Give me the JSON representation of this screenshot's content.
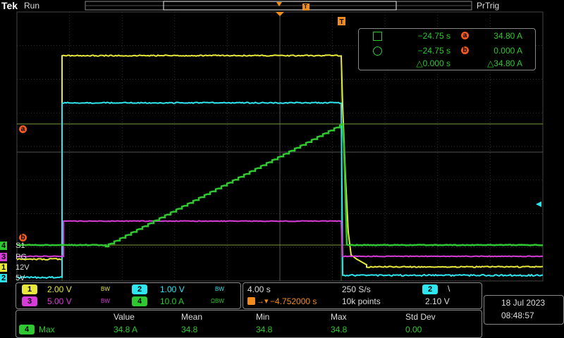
{
  "header": {
    "brand": "Tek",
    "state": "Run",
    "trigger_status": "PrTrig",
    "trigger_marker": "T"
  },
  "cursor_readout": {
    "row1": {
      "time": "−24.75 s",
      "cursor": "a",
      "value": "34.80 A"
    },
    "row2": {
      "time": "−24.75 s",
      "cursor": "b",
      "value": "0.000 A"
    },
    "delta_time": "△0.000 s",
    "delta_value": "△34.80 A"
  },
  "cursors": {
    "a": "a",
    "b": "b"
  },
  "channels": [
    {
      "num": "1",
      "label": "12V",
      "scale": "2.00 V",
      "bw": "BW",
      "color": "#e8e83c"
    },
    {
      "num": "2",
      "label": "5V",
      "scale": "1.00 V",
      "bw": "BW",
      "color": "#2ee6f0"
    },
    {
      "num": "3",
      "label": "PG",
      "scale": "5.00 V",
      "bw": "BW",
      "color": "#d83cd8"
    },
    {
      "num": "4",
      "label": "S1",
      "scale": "10.0 A",
      "bw": "ΩBW",
      "color": "#30c830"
    }
  ],
  "horizontal": {
    "timebase": "4.00 s",
    "sample_rate": "250 S/s",
    "trigger_offset": "−4.752000 s",
    "record_length": "10k points",
    "trigger_source": "2",
    "trigger_slope": "\\",
    "trigger_level": "2.10 V"
  },
  "datetime": {
    "date": "18 Jul  2023",
    "time": "08:48:57"
  },
  "measurements": {
    "headers": [
      "Value",
      "Mean",
      "Min",
      "Max",
      "Std Dev"
    ],
    "row": {
      "channel": "4",
      "name": "Max",
      "value": "34.8 A",
      "mean": "34.8",
      "min": "34.8",
      "max": "34.8",
      "std": "0.00"
    }
  }
}
